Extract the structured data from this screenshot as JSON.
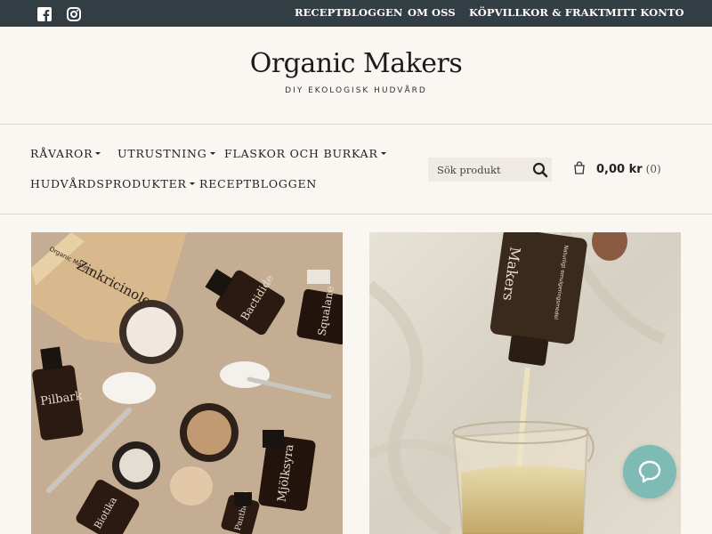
{
  "topbar": {
    "social": [
      "facebook-icon",
      "instagram-icon"
    ],
    "links": [
      "RECEPTBLOGGEN",
      "OM OSS",
      "KÖPVILLKOR & FRAKT",
      "MITT KONTO"
    ]
  },
  "brand": {
    "title": "Organic Makers",
    "tagline": "DIY EKOLOGISK HUDVÅRD"
  },
  "nav": {
    "items": [
      {
        "label": "RÅVAROR",
        "dropdown": true
      },
      {
        "label": "UTRUSTNING",
        "dropdown": true
      },
      {
        "label": "FLASKOR OCH BURKAR",
        "dropdown": true
      },
      {
        "label": "HUDVÅRDSPRODUKTER",
        "dropdown": true
      },
      {
        "label": "RECEPTBLOGGEN",
        "dropdown": false
      }
    ]
  },
  "search": {
    "placeholder": "Sök produkt",
    "icon": "search-icon"
  },
  "cart": {
    "icon": "shopping-bag-icon",
    "amount": "0,00 kr",
    "count": "(0)"
  },
  "photos": {
    "left": {
      "pouch_label": "Zinkricinoleat",
      "pouch_brand": "Organic Makers",
      "bottles": [
        "Pilbark",
        "Bactidide",
        "Squalane",
        "Mjölksyra",
        "Biotika",
        "Panthenol"
      ]
    },
    "right": {
      "bottle_label": "Makers",
      "bottle_sub": "Naturligt emulgeringsmedel"
    }
  },
  "chat": {
    "icon": "chat-bubble-icon"
  },
  "colors": {
    "topbar": "#333d44",
    "background": "#faf7f2",
    "chat": "#7dbbb4"
  }
}
